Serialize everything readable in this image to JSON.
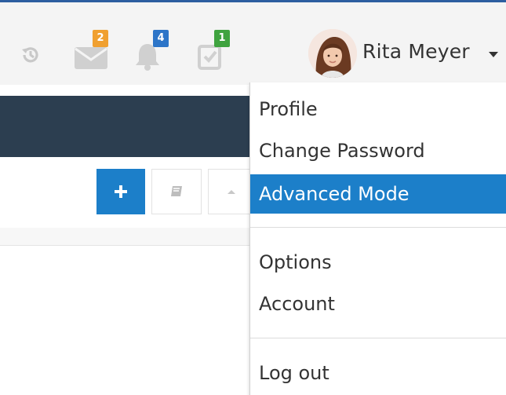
{
  "navbar": {
    "icons": [
      {
        "name": "history-icon",
        "badge": null
      },
      {
        "name": "envelope-icon",
        "badge": "2",
        "badge_color": "#f0a030"
      },
      {
        "name": "bell-icon",
        "badge": "4",
        "badge_color": "#2d75c8"
      },
      {
        "name": "task-check-icon",
        "badge": "1",
        "badge_color": "#3fa33f"
      }
    ],
    "user": {
      "name": "Rita Meyer",
      "avatar": "avatar-photo"
    }
  },
  "toolbar": {
    "buttons": [
      {
        "name": "add-button",
        "icon": "plus-icon",
        "color": "#1c7fc9"
      },
      {
        "name": "book-button",
        "icon": "book-icon"
      },
      {
        "name": "collapse-button",
        "icon": "caret-up-icon"
      }
    ]
  },
  "user_menu": {
    "items": [
      {
        "label": "Profile"
      },
      {
        "label": "Change Password"
      },
      {
        "label": "Advanced Mode",
        "active": true
      },
      {
        "label": "Options"
      },
      {
        "label": "Account"
      },
      {
        "label": "Log out"
      }
    ]
  },
  "colors": {
    "accent": "#1c7fc9",
    "header_dark": "#2c3e50",
    "navbar_bg": "#f4f4f4"
  }
}
